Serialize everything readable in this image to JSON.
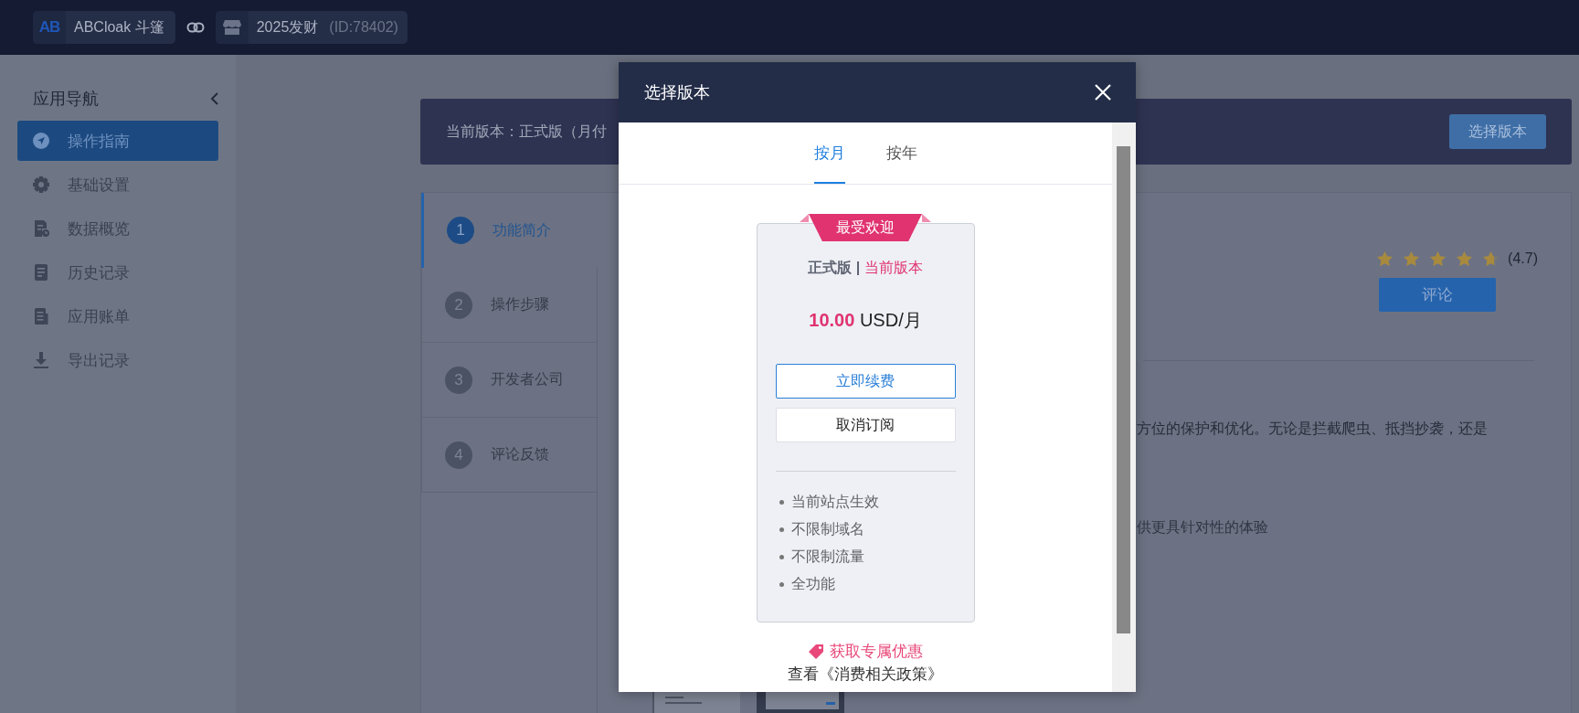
{
  "topbar": {
    "app": {
      "logo": "AB",
      "name": "ABCloak 斗篷"
    },
    "site": {
      "name": "2025发财",
      "id": "(ID:78402)"
    }
  },
  "sidebar": {
    "title": "应用导航",
    "items": [
      {
        "label": "操作指南",
        "selected": true
      },
      {
        "label": "基础设置",
        "selected": false
      },
      {
        "label": "数据概览",
        "selected": false
      },
      {
        "label": "历史记录",
        "selected": false
      },
      {
        "label": "应用账单",
        "selected": false
      },
      {
        "label": "导出记录",
        "selected": false
      }
    ]
  },
  "banner": {
    "text": "当前版本：正式版（月付",
    "button": "选择版本"
  },
  "steps": [
    {
      "number": "1",
      "label": "功能简介",
      "selected": true
    },
    {
      "number": "2",
      "label": "操作步骤",
      "selected": false
    },
    {
      "number": "3",
      "label": "开发者公司",
      "selected": false
    },
    {
      "number": "4",
      "label": "评论反馈",
      "selected": false
    }
  ],
  "rating": {
    "stars": 4.7,
    "value": "(4.7)",
    "button": "评论"
  },
  "description": {
    "line_1": "方位的保护和优化。无论是拦截爬虫、抵挡抄袭，还是",
    "line_2": "供更具针对性的体验"
  },
  "modal": {
    "title": "选择版本",
    "tabs": [
      {
        "label": "按月",
        "selected": true
      },
      {
        "label": "按年",
        "selected": false
      }
    ],
    "plan": {
      "badge": "最受欢迎",
      "name": "正式版",
      "separator": "|",
      "current": "当前版本",
      "price": "10.00",
      "unit": "USD/月",
      "buttons": [
        {
          "label": "立即续费",
          "kind": "primary"
        },
        {
          "label": "取消订阅",
          "kind": "default"
        }
      ],
      "features": [
        "当前站点生效",
        "不限制域名",
        "不限制流量",
        "全功能"
      ]
    },
    "offer_link": "获取专属优惠",
    "policy_link": "查看《消费相关政策》"
  }
}
